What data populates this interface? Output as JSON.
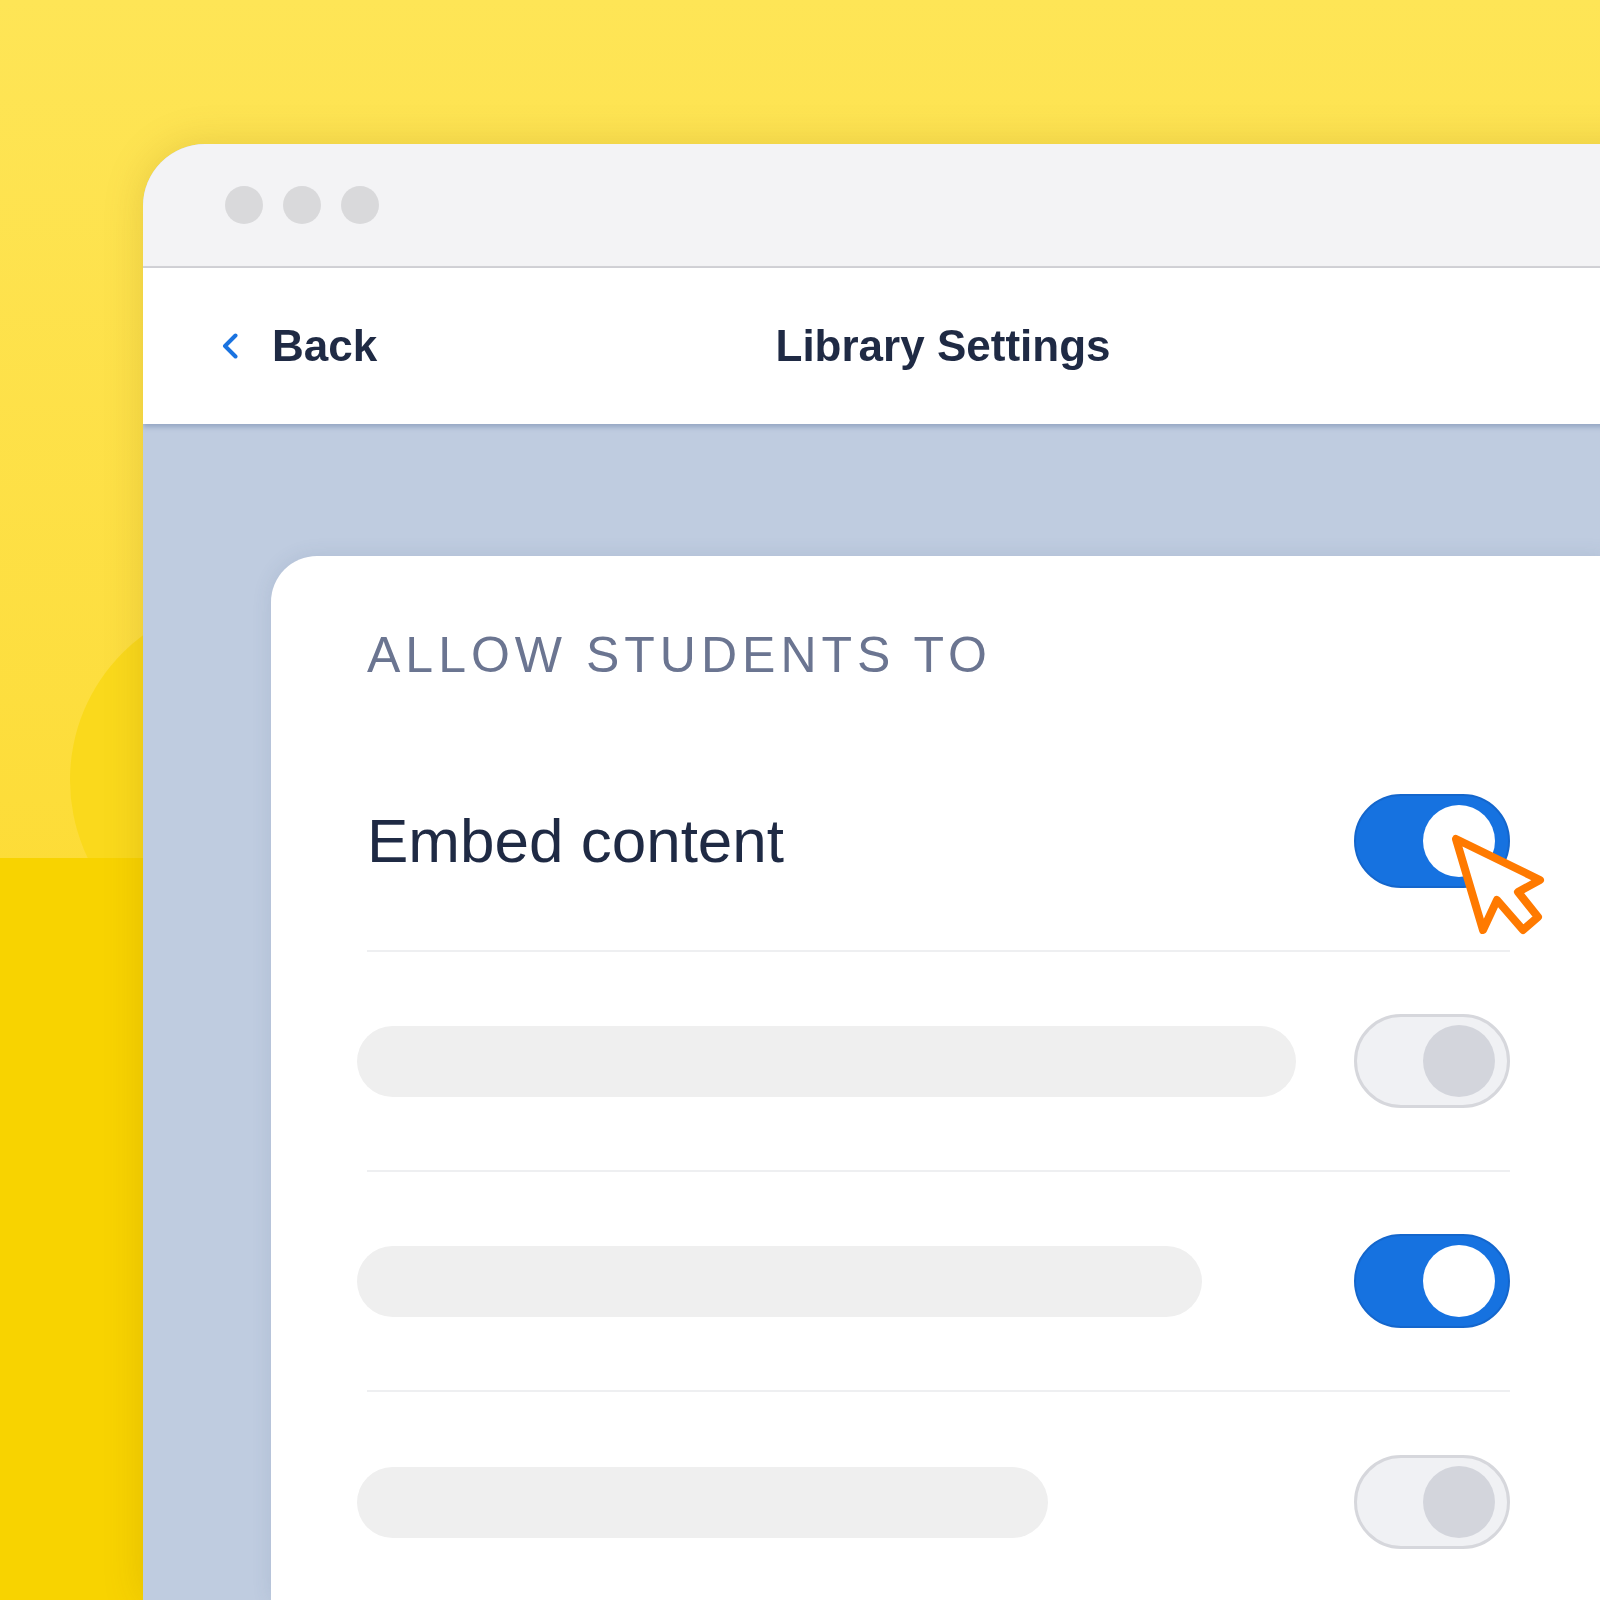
{
  "window": {
    "header": {
      "back_label": "Back",
      "title": "Library Settings"
    }
  },
  "settings": {
    "heading": "ALLOW STUDENTS TO",
    "rows": [
      {
        "kind": "labeled",
        "label": "Embed content",
        "on": true,
        "hovered": true
      },
      {
        "kind": "skeleton",
        "on": false,
        "hovered": false
      },
      {
        "kind": "skeleton",
        "on": true,
        "hovered": false
      },
      {
        "kind": "skeleton",
        "on": false,
        "hovered": false
      }
    ]
  }
}
